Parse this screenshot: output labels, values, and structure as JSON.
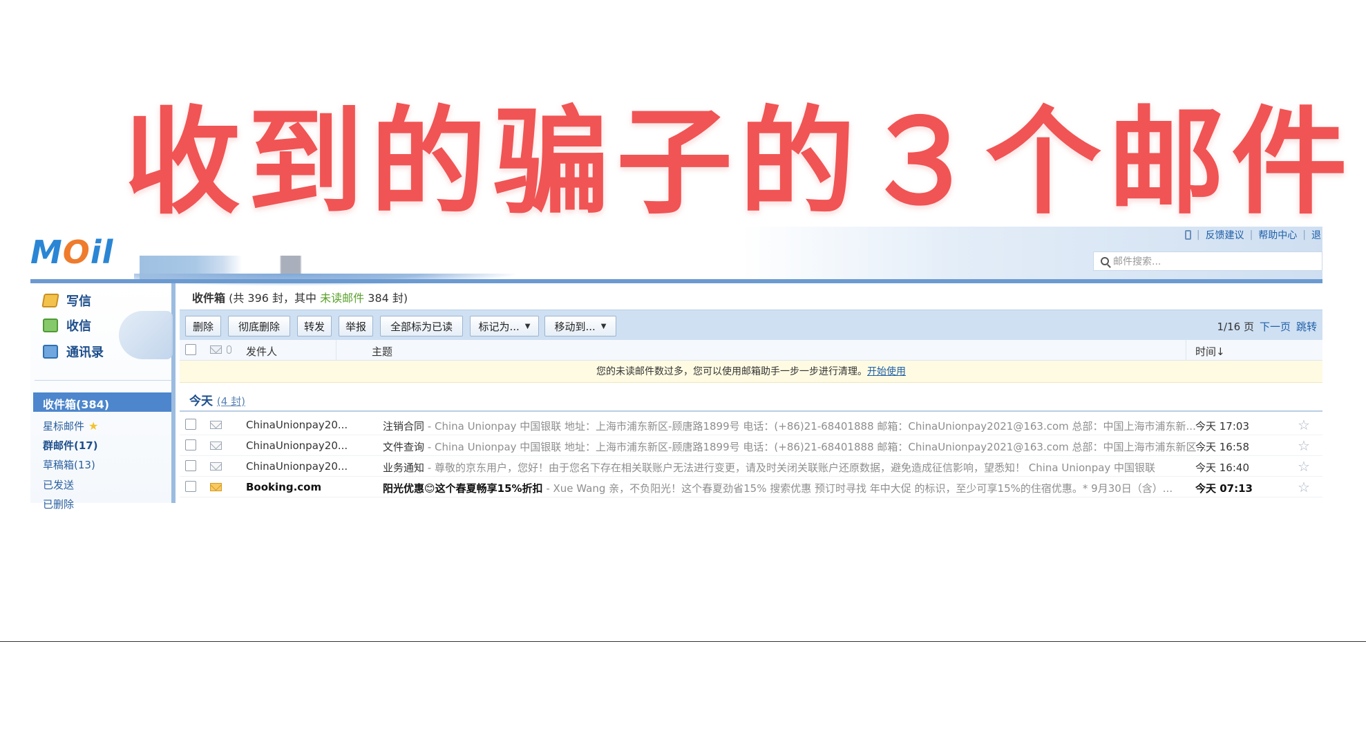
{
  "overlay": {
    "headline": "收到的骗子的３个邮件"
  },
  "app": {
    "logo": {
      "pre": "M",
      "o": "O",
      "post": "il"
    },
    "top_links": [
      "反馈建议",
      "帮助中心",
      "退"
    ],
    "search_placeholder": "邮件搜索..."
  },
  "sidebar": {
    "quick": [
      {
        "label": "写信",
        "icon": "compose-icon"
      },
      {
        "label": "收信",
        "icon": "receive-icon"
      },
      {
        "label": "通讯录",
        "icon": "contacts-icon"
      }
    ],
    "folders": {
      "inbox": "收件箱(384)",
      "starred": "星标邮件",
      "group": "群邮件(17)",
      "drafts": "草稿箱(13)",
      "sent": "已发送",
      "deleted": "已删除"
    }
  },
  "main": {
    "title": {
      "name": "收件箱",
      "part1": " (共 396 封，其中 ",
      "unread_label": "未读邮件",
      "part2": " 384 封)"
    },
    "toolbar": {
      "buttons": [
        "删除",
        "彻底删除",
        "转发",
        "举报",
        "全部标为已读",
        "标记为...",
        "移动到..."
      ],
      "pager": {
        "page": "1/16 页",
        "next": "下一页",
        "jump": "跳转"
      }
    },
    "columns": {
      "sender": "发件人",
      "subject": "主题",
      "time": "时间↓"
    },
    "notice": {
      "text": "您的未读邮件数过多，您可以使用邮箱助手一步一步进行清理。",
      "link": "开始使用"
    },
    "group": {
      "label": "今天",
      "count": "(4 封)"
    },
    "emails": [
      {
        "sender": "ChinaUnionpay20...",
        "subject": "注销合同",
        "preview": " - China Unionpay  中国银联  地址：上海市浦东新区-顾唐路1899号 电话：(+86)21-68401888 邮箱：ChinaUnionpay2021@163.com 总部：中国上海市浦东新...",
        "time": "今天 17:03",
        "unread": false
      },
      {
        "sender": "ChinaUnionpay20...",
        "subject": "文件查询",
        "preview": " - China Unionpay 中国银联  地址：上海市浦东新区-顾唐路1899号 电话：(+86)21-68401888 邮箱：ChinaUnionpay2021@163.com 总部：中国上海市浦东新区...",
        "time": "今天 16:58",
        "unread": false
      },
      {
        "sender": "ChinaUnionpay20...",
        "subject": "业务通知",
        "preview": " - 尊敬的京东用户，您好！由于您名下存在相关联账户无法进行变更，请及时关闭关联账户还原数据，避免造成征信影响，望悉知！  China Unionpay 中国银联",
        "time": "今天 16:40",
        "unread": false
      },
      {
        "sender": "Booking.com",
        "subject": "阳光优惠😊这个春夏畅享15%折扣",
        "preview": " - Xue Wang    亲，不负阳光！这个春夏劲省15% 搜索优惠   预订时寻找 年中大促 的标识，至少可享15%的住宿优惠。* 9月30日（含）...",
        "time": "今天 07:13",
        "unread": true
      }
    ]
  }
}
